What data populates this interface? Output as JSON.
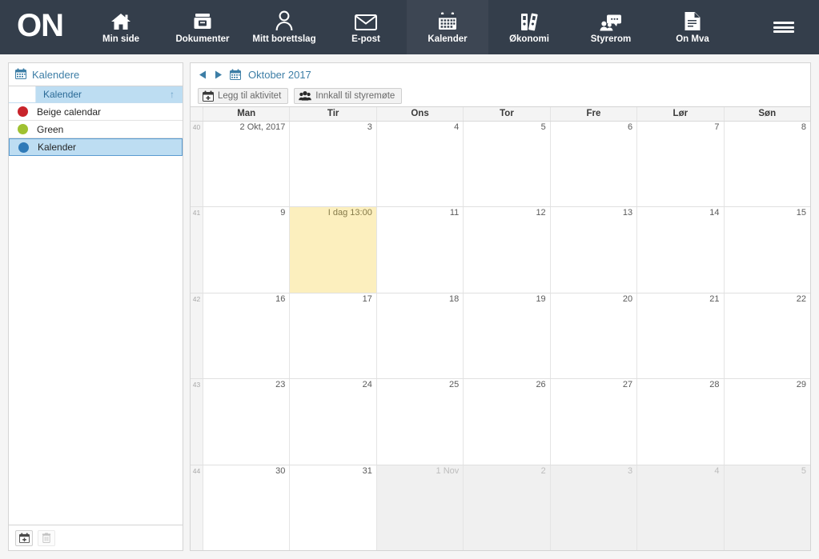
{
  "brand": {
    "logo_text": "ON"
  },
  "navbar": {
    "items": [
      {
        "label": "Min side",
        "icon": "home-icon",
        "active": false
      },
      {
        "label": "Dokumenter",
        "icon": "documents-icon",
        "active": false
      },
      {
        "label": "Mitt borettslag",
        "icon": "person-icon",
        "active": false
      },
      {
        "label": "E-post",
        "icon": "envelope-icon",
        "active": false
      },
      {
        "label": "Kalender",
        "icon": "calendar-icon",
        "active": true
      },
      {
        "label": "Økonomi",
        "icon": "binders-icon",
        "active": false
      },
      {
        "label": "Styrerom",
        "icon": "chat-group-icon",
        "active": false
      },
      {
        "label": "On Mva",
        "icon": "document-icon",
        "active": false
      }
    ],
    "menu_icon": "hamburger-menu-icon"
  },
  "sidebar": {
    "header": {
      "icon": "calendar-icon",
      "title": "Kalendere"
    },
    "grid": {
      "columns": [
        {
          "header": ""
        },
        {
          "header": "Kalender",
          "sort": "↑"
        }
      ],
      "rows": [
        {
          "name": "Beige calendar",
          "color": "#c8242b",
          "selected": false
        },
        {
          "name": "Green",
          "color": "#9fc131",
          "selected": false
        },
        {
          "name": "Kalender",
          "color": "#2f7ab8",
          "selected": true
        }
      ]
    },
    "footer": {
      "add_button": {
        "icon": "calendar-plus-icon",
        "label": ""
      },
      "delete_button": {
        "icon": "trash-icon",
        "label": "",
        "disabled": true
      }
    }
  },
  "calendar": {
    "nav": {
      "prev_icon": "triangle-left-icon",
      "next_icon": "triangle-right-icon",
      "date_icon": "calendar-icon",
      "title": "Oktober 2017"
    },
    "toolbar": {
      "buttons": [
        {
          "label": "Legg til aktivitet",
          "icon": "calendar-plus-icon"
        },
        {
          "label": "Innkall til styremøte",
          "icon": "people-group-icon"
        }
      ]
    },
    "day_headers": [
      "Man",
      "Tir",
      "Ons",
      "Tor",
      "Fre",
      "Lør",
      "Søn"
    ],
    "weeks": [
      {
        "week_number": "40",
        "days": [
          {
            "label": "2 Okt, 2017",
            "other_month": false,
            "today": false
          },
          {
            "label": "3",
            "other_month": false,
            "today": false
          },
          {
            "label": "4",
            "other_month": false,
            "today": false
          },
          {
            "label": "5",
            "other_month": false,
            "today": false
          },
          {
            "label": "6",
            "other_month": false,
            "today": false
          },
          {
            "label": "7",
            "other_month": false,
            "today": false
          },
          {
            "label": "8",
            "other_month": false,
            "today": false
          }
        ]
      },
      {
        "week_number": "41",
        "days": [
          {
            "label": "9",
            "other_month": false,
            "today": false
          },
          {
            "label": "I dag 13:00",
            "other_month": false,
            "today": true
          },
          {
            "label": "11",
            "other_month": false,
            "today": false
          },
          {
            "label": "12",
            "other_month": false,
            "today": false
          },
          {
            "label": "13",
            "other_month": false,
            "today": false
          },
          {
            "label": "14",
            "other_month": false,
            "today": false
          },
          {
            "label": "15",
            "other_month": false,
            "today": false
          }
        ]
      },
      {
        "week_number": "42",
        "days": [
          {
            "label": "16",
            "other_month": false,
            "today": false
          },
          {
            "label": "17",
            "other_month": false,
            "today": false
          },
          {
            "label": "18",
            "other_month": false,
            "today": false
          },
          {
            "label": "19",
            "other_month": false,
            "today": false
          },
          {
            "label": "20",
            "other_month": false,
            "today": false
          },
          {
            "label": "21",
            "other_month": false,
            "today": false
          },
          {
            "label": "22",
            "other_month": false,
            "today": false
          }
        ]
      },
      {
        "week_number": "43",
        "days": [
          {
            "label": "23",
            "other_month": false,
            "today": false
          },
          {
            "label": "24",
            "other_month": false,
            "today": false
          },
          {
            "label": "25",
            "other_month": false,
            "today": false
          },
          {
            "label": "26",
            "other_month": false,
            "today": false
          },
          {
            "label": "27",
            "other_month": false,
            "today": false
          },
          {
            "label": "28",
            "other_month": false,
            "today": false
          },
          {
            "label": "29",
            "other_month": false,
            "today": false
          }
        ]
      },
      {
        "week_number": "44",
        "days": [
          {
            "label": "30",
            "other_month": false,
            "today": false
          },
          {
            "label": "31",
            "other_month": false,
            "today": false
          },
          {
            "label": "1 Nov",
            "other_month": true,
            "today": false
          },
          {
            "label": "2",
            "other_month": true,
            "today": false
          },
          {
            "label": "3",
            "other_month": true,
            "today": false
          },
          {
            "label": "4",
            "other_month": true,
            "today": false
          },
          {
            "label": "5",
            "other_month": true,
            "today": false
          }
        ]
      }
    ]
  },
  "colors": {
    "navbar_bg": "#343e4b",
    "navbar_active_bg": "#3d4653",
    "accent": "#3d7ea6",
    "today_bg": "#fcefbe",
    "selected_row_bg": "#bdddf2"
  }
}
